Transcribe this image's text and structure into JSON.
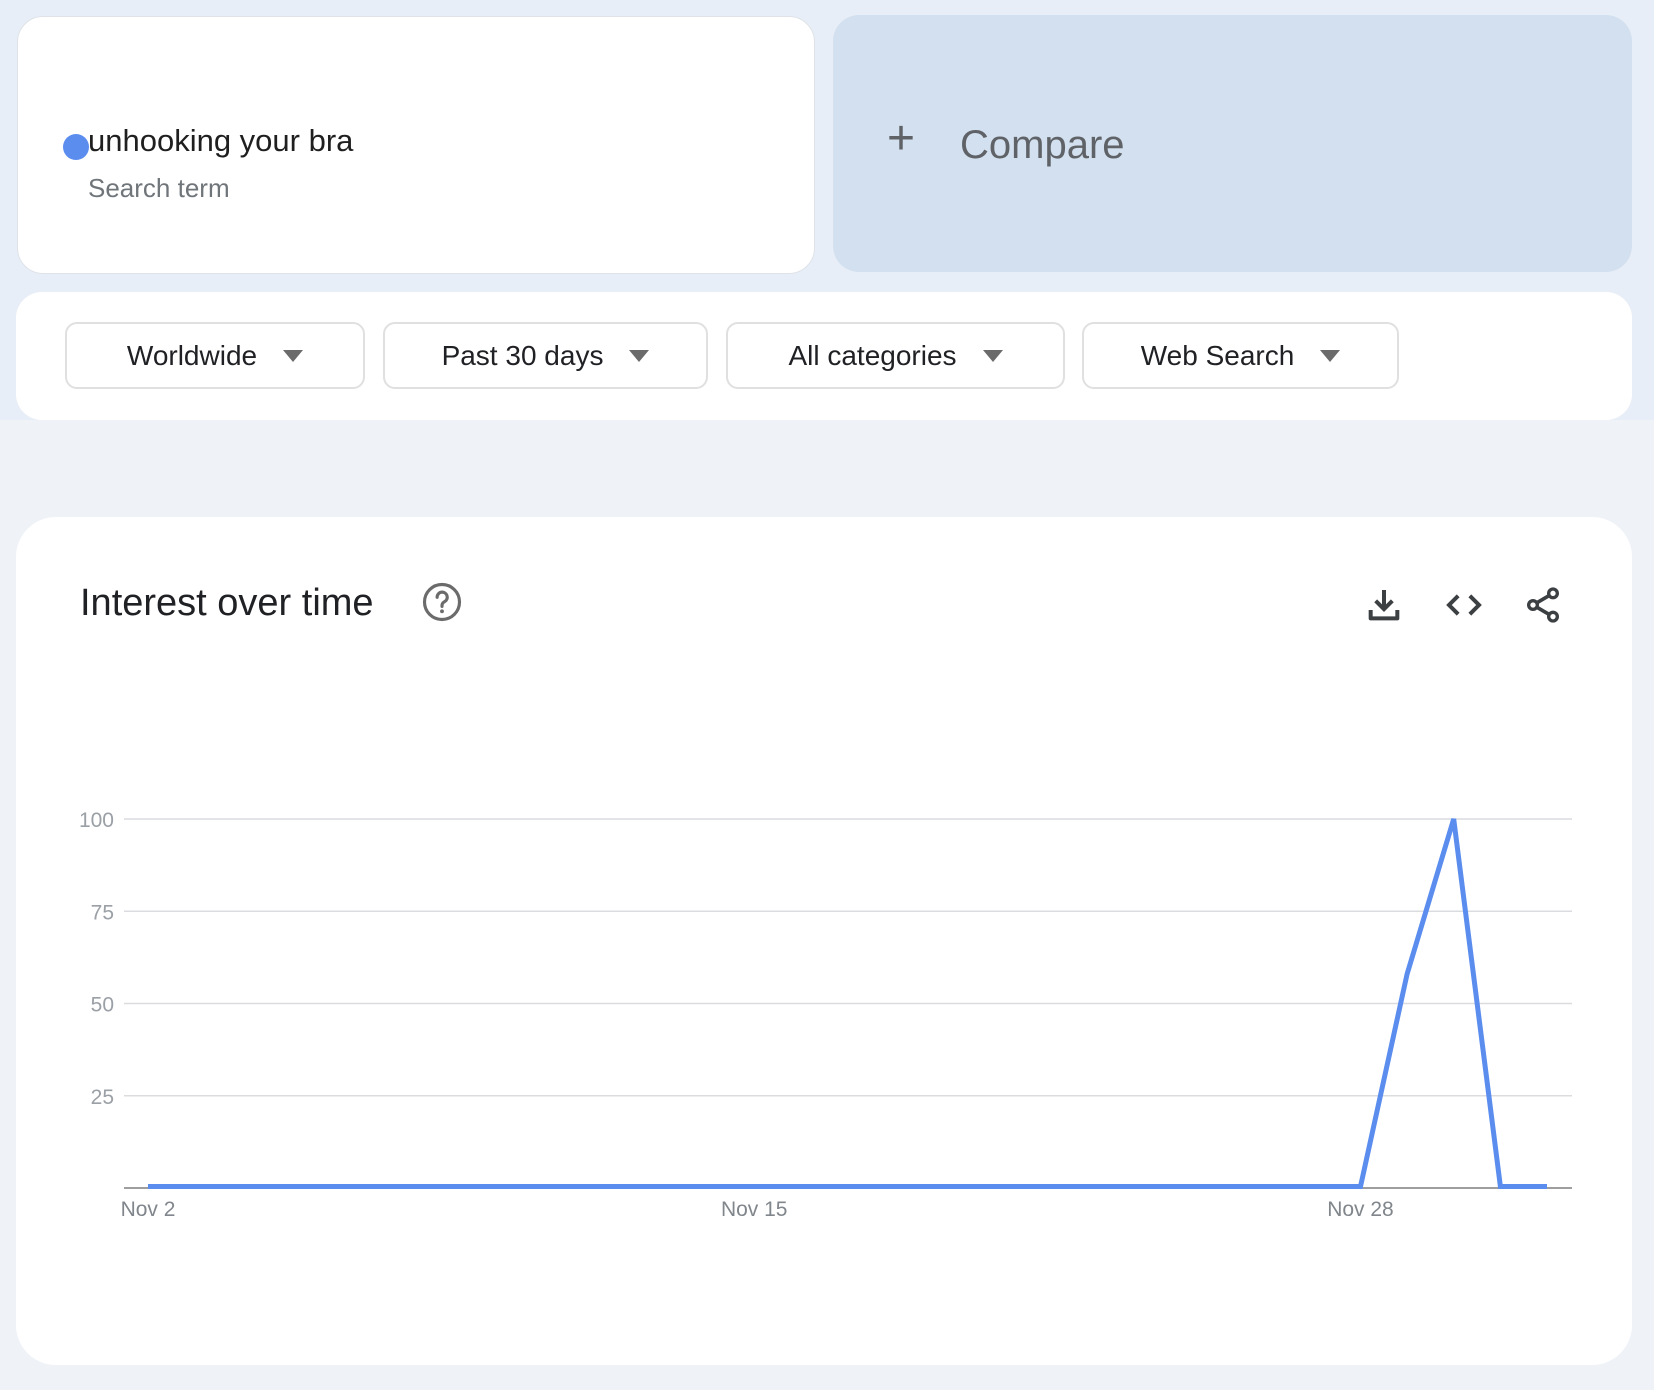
{
  "search_term": {
    "term": "unhooking your bra",
    "subtitle": "Search term",
    "color": "#5b8def"
  },
  "compare": {
    "icon": "plus-icon",
    "label": "Compare",
    "plus_glyph": "+"
  },
  "filters": [
    {
      "label": "Worldwide",
      "icon": "dropdown-caret-icon"
    },
    {
      "label": "Past 30 days",
      "icon": "dropdown-caret-icon"
    },
    {
      "label": "All categories",
      "icon": "dropdown-caret-icon"
    },
    {
      "label": "Web Search",
      "icon": "dropdown-caret-icon"
    }
  ],
  "panel": {
    "title": "Interest over time",
    "help_icon": "help-circle-icon",
    "actions": [
      "download-icon",
      "embed-code-icon",
      "share-icon"
    ]
  },
  "chart_data": {
    "type": "line",
    "title": "Interest over time",
    "xlabel": "",
    "ylabel": "",
    "ylim": [
      0,
      100
    ],
    "yticks": [
      25,
      50,
      75,
      100
    ],
    "grid": true,
    "x": [
      "Nov 2",
      "Nov 3",
      "Nov 4",
      "Nov 5",
      "Nov 6",
      "Nov 7",
      "Nov 8",
      "Nov 9",
      "Nov 10",
      "Nov 11",
      "Nov 12",
      "Nov 13",
      "Nov 14",
      "Nov 15",
      "Nov 16",
      "Nov 17",
      "Nov 18",
      "Nov 19",
      "Nov 20",
      "Nov 21",
      "Nov 22",
      "Nov 23",
      "Nov 24",
      "Nov 25",
      "Nov 26",
      "Nov 27",
      "Nov 28",
      "Nov 29",
      "Nov 30",
      "Dec 1",
      "Dec 2"
    ],
    "xtick_labels": [
      "Nov 2",
      "Nov 15",
      "Nov 28"
    ],
    "series": [
      {
        "name": "unhooking your bra",
        "color": "#5b8def",
        "values": [
          0,
          0,
          0,
          0,
          0,
          0,
          0,
          0,
          0,
          0,
          0,
          0,
          0,
          0,
          0,
          0,
          0,
          0,
          0,
          0,
          0,
          0,
          0,
          0,
          0,
          0,
          0,
          58,
          100,
          0,
          0
        ]
      }
    ],
    "legend": "none"
  }
}
